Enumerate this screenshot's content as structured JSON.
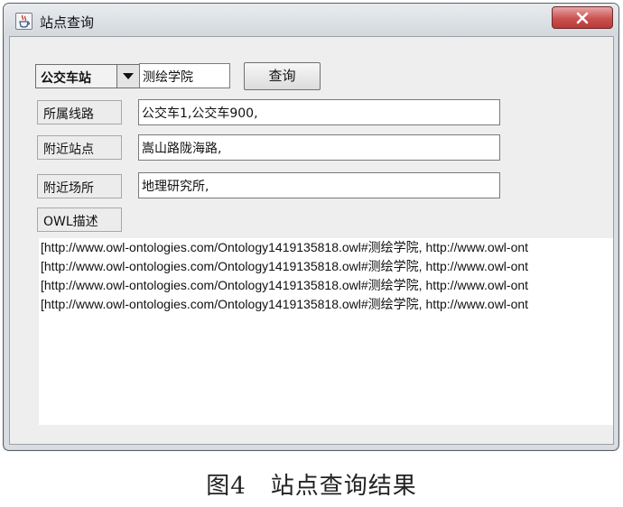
{
  "window": {
    "title": "站点查询",
    "close_label": "X"
  },
  "toolbar": {
    "type_selected": "公交车站",
    "search_value": "测绘学院",
    "query_label": "查询"
  },
  "fields": [
    {
      "label": "所属线路",
      "value": "公交车1,公交车900,"
    },
    {
      "label": "附近站点",
      "value": "嵩山路陇海路,"
    },
    {
      "label": "附近场所",
      "value": "地理研究所,"
    }
  ],
  "owl_label": "OWL描述",
  "owl_lines": [
    "[http://www.owl-ontologies.com/Ontology1419135818.owl#测绘学院, http://www.owl-ont",
    "[http://www.owl-ontologies.com/Ontology1419135818.owl#测绘学院, http://www.owl-ont",
    "[http://www.owl-ontologies.com/Ontology1419135818.owl#测绘学院, http://www.owl-ont",
    "[http://www.owl-ontologies.com/Ontology1419135818.owl#测绘学院, http://www.owl-ont"
  ],
  "caption": "图4　站点查询结果",
  "icons": {
    "app": "java-coffee-cup-icon",
    "close": "close-icon",
    "dropdown": "chevron-down-icon"
  }
}
